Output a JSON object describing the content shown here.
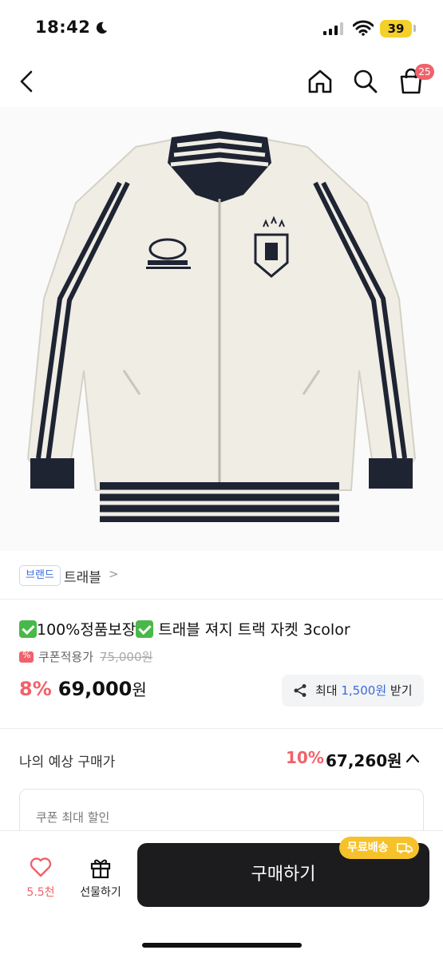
{
  "status_bar": {
    "time": "18:42",
    "battery": "39"
  },
  "nav": {
    "back_icon": "chevron-left-icon",
    "home_icon": "home-icon",
    "search_icon": "search-icon",
    "cart_icon": "shopping-bag-icon",
    "cart_count": "25"
  },
  "product": {
    "image_alt": "track jacket",
    "brand_badge": "브랜드",
    "brand_name": "트래블",
    "title_part1": "100%정품보장",
    "title_part2": " 트래블 져지 트랙 자켓 3color",
    "coupon_label": "쿠폰적용가",
    "original_price": "75,000원",
    "discount": "8%",
    "price": "69,000",
    "price_unit": "원",
    "share_prefix": "최대 ",
    "share_amount": "1,500원",
    "share_suffix": " 받기"
  },
  "expected": {
    "label": "나의 예상 구매가",
    "discount": "10%",
    "price": "67,260원",
    "coupon_card_label": "쿠폰 최대 할인"
  },
  "bottom_bar": {
    "like_count": "5.5천",
    "gift_label": "선물하기",
    "buy_label": "구매하기",
    "free_shipping": "무료배송"
  },
  "colors": {
    "accent_red": "#f0626b",
    "accent_blue": "#3a6ad8",
    "buy_button": "#1c1c1e",
    "shipping_badge": "#f6c22b"
  }
}
